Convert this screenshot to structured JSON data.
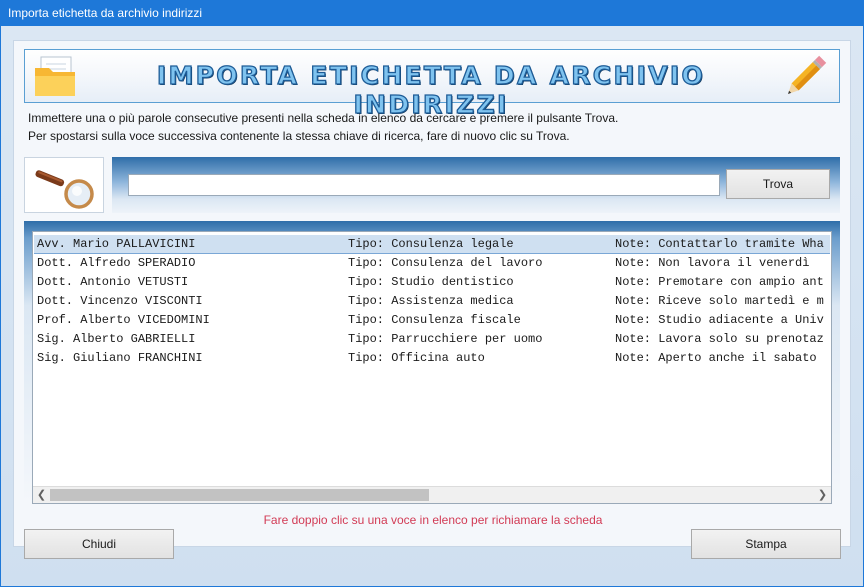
{
  "window": {
    "title": "Importa etichetta da archivio indirizzi"
  },
  "banner": {
    "title": "IMPORTA ETICHETTA DA ARCHIVIO INDIRIZZI",
    "left_icon": "folder-icon",
    "right_icon": "pencil-icon"
  },
  "instructions": {
    "line1": "Immettere una o più parole consecutive presenti nella scheda in elenco da cercare e premere il pulsante Trova.",
    "line2": "Per spostarsi sulla voce successiva contenente la stessa chiave di ricerca, fare di nuovo clic su Trova."
  },
  "search": {
    "icon": "magnifier-icon",
    "value": "",
    "button_label": "Trova"
  },
  "list": {
    "selected_index": 0,
    "rows": [
      {
        "name": "Avv. Mario PALLAVICINI",
        "tipo": "Tipo: Consulenza legale",
        "note": "Note: Contattarlo tramite Wha"
      },
      {
        "name": "Dott. Alfredo SPERADIO",
        "tipo": "Tipo: Consulenza del lavoro",
        "note": "Note: Non lavora il venerdì"
      },
      {
        "name": "Dott. Antonio VETUSTI",
        "tipo": "Tipo: Studio dentistico",
        "note": "Note: Premotare con ampio ant"
      },
      {
        "name": "Dott. Vincenzo VISCONTI",
        "tipo": "Tipo: Assistenza medica",
        "note": "Note: Riceve solo martedì e m"
      },
      {
        "name": "Prof. Alberto VICEDOMINI",
        "tipo": "Tipo: Consulenza fiscale",
        "note": "Note: Studio adiacente a Univ"
      },
      {
        "name": "Sig. Alberto GABRIELLI",
        "tipo": "Tipo: Parrucchiere per uomo",
        "note": "Note: Lavora solo su prenotaz"
      },
      {
        "name": "Sig. Giuliano FRANCHINI",
        "tipo": "Tipo: Officina auto",
        "note": "Note: Aperto anche il sabato"
      }
    ]
  },
  "hint": "Fare doppio clic su una voce in elenco per richiamare la scheda",
  "footer": {
    "close_label": "Chiudi",
    "print_label": "Stampa"
  },
  "colors": {
    "titlebar": "#1e78d8",
    "hint": "#d23b55",
    "selection": "#cfe0f1"
  }
}
